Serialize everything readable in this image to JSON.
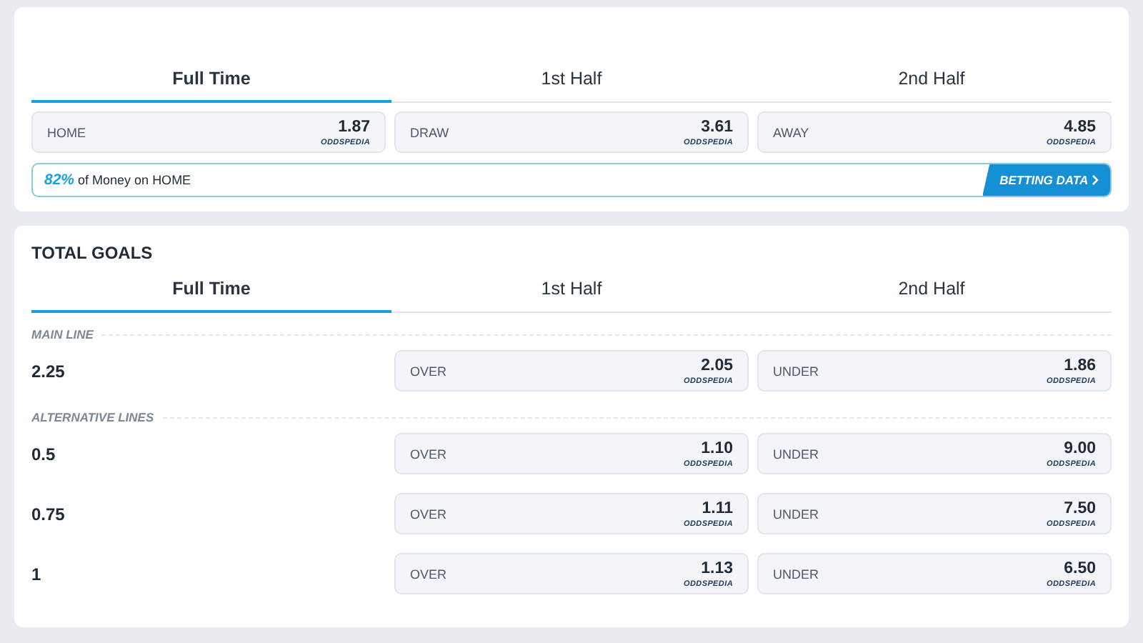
{
  "match_result": {
    "tabs": [
      {
        "label": "Full Time",
        "selected": true
      },
      {
        "label": "1st Half",
        "selected": false
      },
      {
        "label": "2nd Half",
        "selected": false
      }
    ],
    "odds": [
      {
        "label": "HOME",
        "value": "1.87",
        "bookmaker": "ODDSPEDIA"
      },
      {
        "label": "DRAW",
        "value": "3.61",
        "bookmaker": "ODDSPEDIA"
      },
      {
        "label": "AWAY",
        "value": "4.85",
        "bookmaker": "ODDSPEDIA"
      }
    ],
    "money": {
      "percent": "82%",
      "text": "of Money on HOME",
      "button": "BETTING DATA"
    }
  },
  "total_goals": {
    "title": "TOTAL GOALS",
    "tabs": [
      {
        "label": "Full Time",
        "selected": true
      },
      {
        "label": "1st Half",
        "selected": false
      },
      {
        "label": "2nd Half",
        "selected": false
      }
    ],
    "sections": [
      {
        "heading": "MAIN LINE",
        "rows": [
          {
            "line": "2.25",
            "over": {
              "label": "OVER",
              "value": "2.05",
              "bookmaker": "ODDSPEDIA"
            },
            "under": {
              "label": "UNDER",
              "value": "1.86",
              "bookmaker": "ODDSPEDIA"
            }
          }
        ]
      },
      {
        "heading": "ALTERNATIVE LINES",
        "rows": [
          {
            "line": "0.5",
            "over": {
              "label": "OVER",
              "value": "1.10",
              "bookmaker": "ODDSPEDIA"
            },
            "under": {
              "label": "UNDER",
              "value": "9.00",
              "bookmaker": "ODDSPEDIA"
            }
          },
          {
            "line": "0.75",
            "over": {
              "label": "OVER",
              "value": "1.11",
              "bookmaker": "ODDSPEDIA"
            },
            "under": {
              "label": "UNDER",
              "value": "7.50",
              "bookmaker": "ODDSPEDIA"
            }
          },
          {
            "line": "1",
            "over": {
              "label": "OVER",
              "value": "1.13",
              "bookmaker": "ODDSPEDIA"
            },
            "under": {
              "label": "UNDER",
              "value": "6.50",
              "bookmaker": "ODDSPEDIA"
            }
          }
        ]
      }
    ]
  }
}
